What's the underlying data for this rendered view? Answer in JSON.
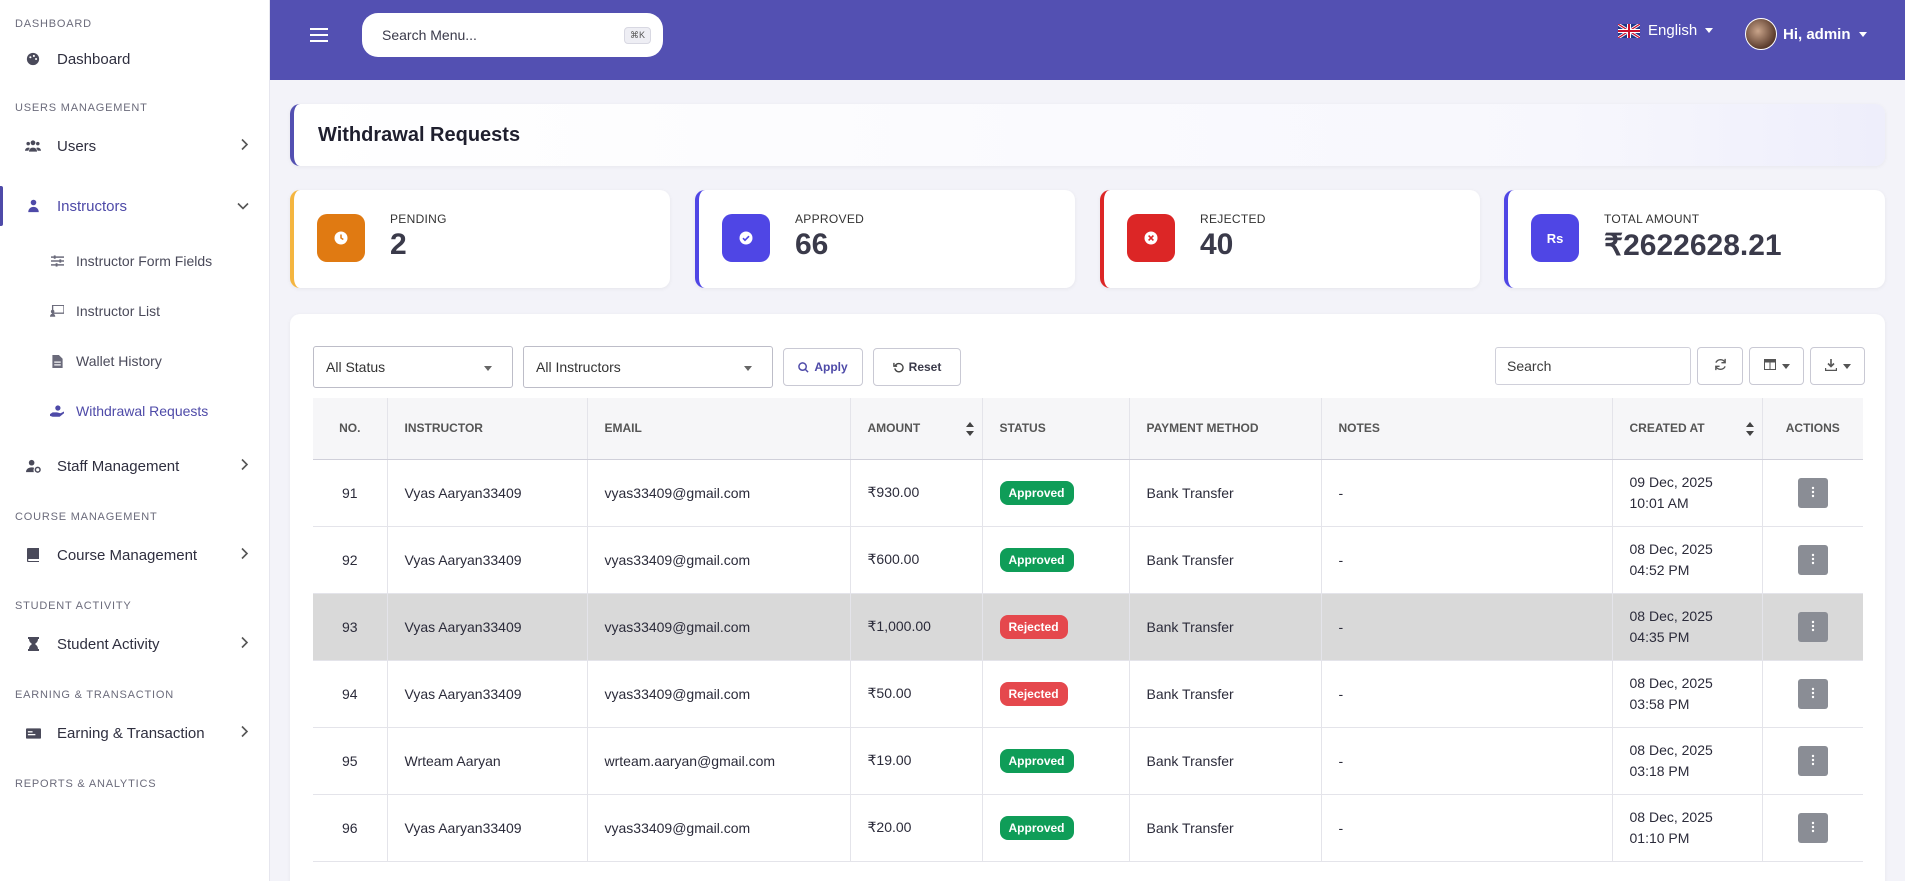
{
  "sidebar": {
    "sections": [
      {
        "title": "DASHBOARD",
        "items": [
          {
            "label": "Dashboard",
            "icon": "palette-icon"
          }
        ]
      },
      {
        "title": "USERS MANAGEMENT",
        "items": [
          {
            "label": "Users",
            "icon": "users-icon"
          },
          {
            "label": "Instructors",
            "icon": "user-icon"
          }
        ]
      },
      {
        "title": "COURSE MANAGEMENT"
      },
      {
        "title": "STUDENT ACTIVITY"
      },
      {
        "title": "EARNING & TRANSACTION"
      },
      {
        "title": "REPORTS & ANALYTICS"
      }
    ],
    "instructors_sub": [
      {
        "label": "Instructor Form Fields"
      },
      {
        "label": "Instructor List"
      },
      {
        "label": "Wallet History"
      },
      {
        "label": "Withdrawal Requests"
      }
    ],
    "staff": "Staff Management",
    "course": "Course Management",
    "student": "Student Activity",
    "earning": "Earning & Transaction"
  },
  "header": {
    "search_placeholder": "Search Menu...",
    "search_shortcut": "⌘K",
    "language": "English",
    "user_greeting": "Hi, admin"
  },
  "page": {
    "title": "Withdrawal Requests"
  },
  "stats": [
    {
      "label": "PENDING",
      "value": "2",
      "color": "#e07a12",
      "icon": "clock-icon"
    },
    {
      "label": "APPROVED",
      "value": "66",
      "color": "#4f46e5",
      "icon": "check-circle-icon"
    },
    {
      "label": "REJECTED",
      "value": "40",
      "color": "#dc2626",
      "icon": "x-circle-icon"
    },
    {
      "label": "TOTAL AMOUNT",
      "value": "₹2622628.21",
      "color": "#4f46e5",
      "icon": "rupee-icon",
      "icon_text": "Rs"
    }
  ],
  "filters": {
    "status": "All Status",
    "instructor": "All Instructors",
    "apply": "Apply",
    "reset": "Reset",
    "search_placeholder": "Search"
  },
  "table": {
    "columns": [
      "NO.",
      "INSTRUCTOR",
      "EMAIL",
      "AMOUNT",
      "STATUS",
      "PAYMENT METHOD",
      "NOTES",
      "CREATED AT",
      "ACTIONS"
    ],
    "rows": [
      {
        "no": "91",
        "instructor": "Vyas Aaryan33409",
        "email": "vyas33409@gmail.com",
        "amount": "₹930.00",
        "status": "Approved",
        "method": "Bank Transfer",
        "notes": "-",
        "date": "09 Dec, 2025",
        "time": "10:01 AM"
      },
      {
        "no": "92",
        "instructor": "Vyas Aaryan33409",
        "email": "vyas33409@gmail.com",
        "amount": "₹600.00",
        "status": "Approved",
        "method": "Bank Transfer",
        "notes": "-",
        "date": "08 Dec, 2025",
        "time": "04:52 PM"
      },
      {
        "no": "93",
        "instructor": "Vyas Aaryan33409",
        "email": "vyas33409@gmail.com",
        "amount": "₹1,000.00",
        "status": "Rejected",
        "method": "Bank Transfer",
        "notes": "-",
        "date": "08 Dec, 2025",
        "time": "04:35 PM"
      },
      {
        "no": "94",
        "instructor": "Vyas Aaryan33409",
        "email": "vyas33409@gmail.com",
        "amount": "₹50.00",
        "status": "Rejected",
        "method": "Bank Transfer",
        "notes": "-",
        "date": "08 Dec, 2025",
        "time": "03:58 PM"
      },
      {
        "no": "95",
        "instructor": "Wrteam Aaryan",
        "email": "wrteam.aaryan@gmail.com",
        "amount": "₹19.00",
        "status": "Approved",
        "method": "Bank Transfer",
        "notes": "-",
        "date": "08 Dec, 2025",
        "time": "03:18 PM"
      },
      {
        "no": "96",
        "instructor": "Vyas Aaryan33409",
        "email": "vyas33409@gmail.com",
        "amount": "₹20.00",
        "status": "Approved",
        "method": "Bank Transfer",
        "notes": "-",
        "date": "08 Dec, 2025",
        "time": "01:10 PM"
      }
    ]
  },
  "colors": {
    "primary": "#5350b2",
    "approved": "#0f9d58",
    "rejected": "#e5484d"
  }
}
